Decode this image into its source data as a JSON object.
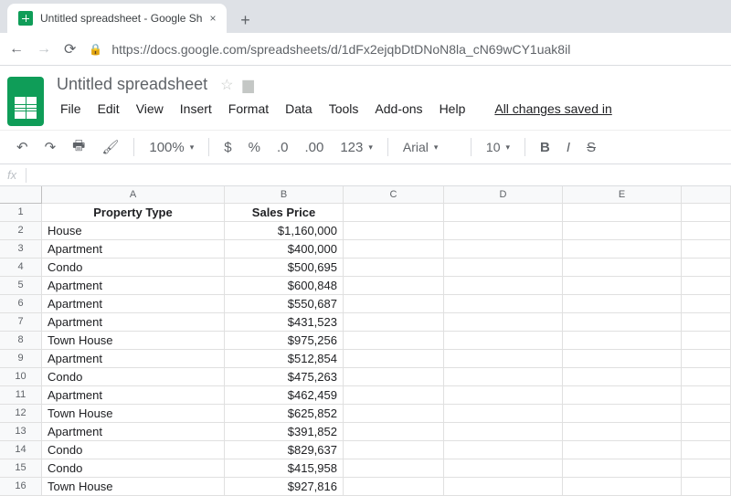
{
  "browser": {
    "tab_title": "Untitled spreadsheet - Google Sh",
    "url": "https://docs.google.com/spreadsheets/d/1dFx2ejqbDtDNoN8la_cN69wCY1uak8il"
  },
  "doc": {
    "title": "Untitled spreadsheet",
    "save_status": "All changes saved in"
  },
  "menus": [
    "File",
    "Edit",
    "View",
    "Insert",
    "Format",
    "Data",
    "Tools",
    "Add-ons",
    "Help"
  ],
  "toolbar": {
    "zoom": "100%",
    "font": "Arial",
    "font_size": "10"
  },
  "columns": [
    "A",
    "B",
    "C",
    "D",
    "E"
  ],
  "sheet": {
    "headers": [
      "Property Type",
      "Sales Price"
    ],
    "rows": [
      {
        "type": "House",
        "price": "$1,160,000"
      },
      {
        "type": "Apartment",
        "price": "$400,000"
      },
      {
        "type": "Condo",
        "price": "$500,695"
      },
      {
        "type": "Apartment",
        "price": "$600,848"
      },
      {
        "type": "Apartment",
        "price": "$550,687"
      },
      {
        "type": "Apartment",
        "price": "$431,523"
      },
      {
        "type": "Town House",
        "price": "$975,256"
      },
      {
        "type": "Apartment",
        "price": "$512,854"
      },
      {
        "type": "Condo",
        "price": "$475,263"
      },
      {
        "type": "Apartment",
        "price": "$462,459"
      },
      {
        "type": "Town House",
        "price": "$625,852"
      },
      {
        "type": "Apartment",
        "price": "$391,852"
      },
      {
        "type": "Condo",
        "price": "$829,637"
      },
      {
        "type": "Condo",
        "price": "$415,958"
      },
      {
        "type": "Town House",
        "price": "$927,816"
      }
    ]
  }
}
